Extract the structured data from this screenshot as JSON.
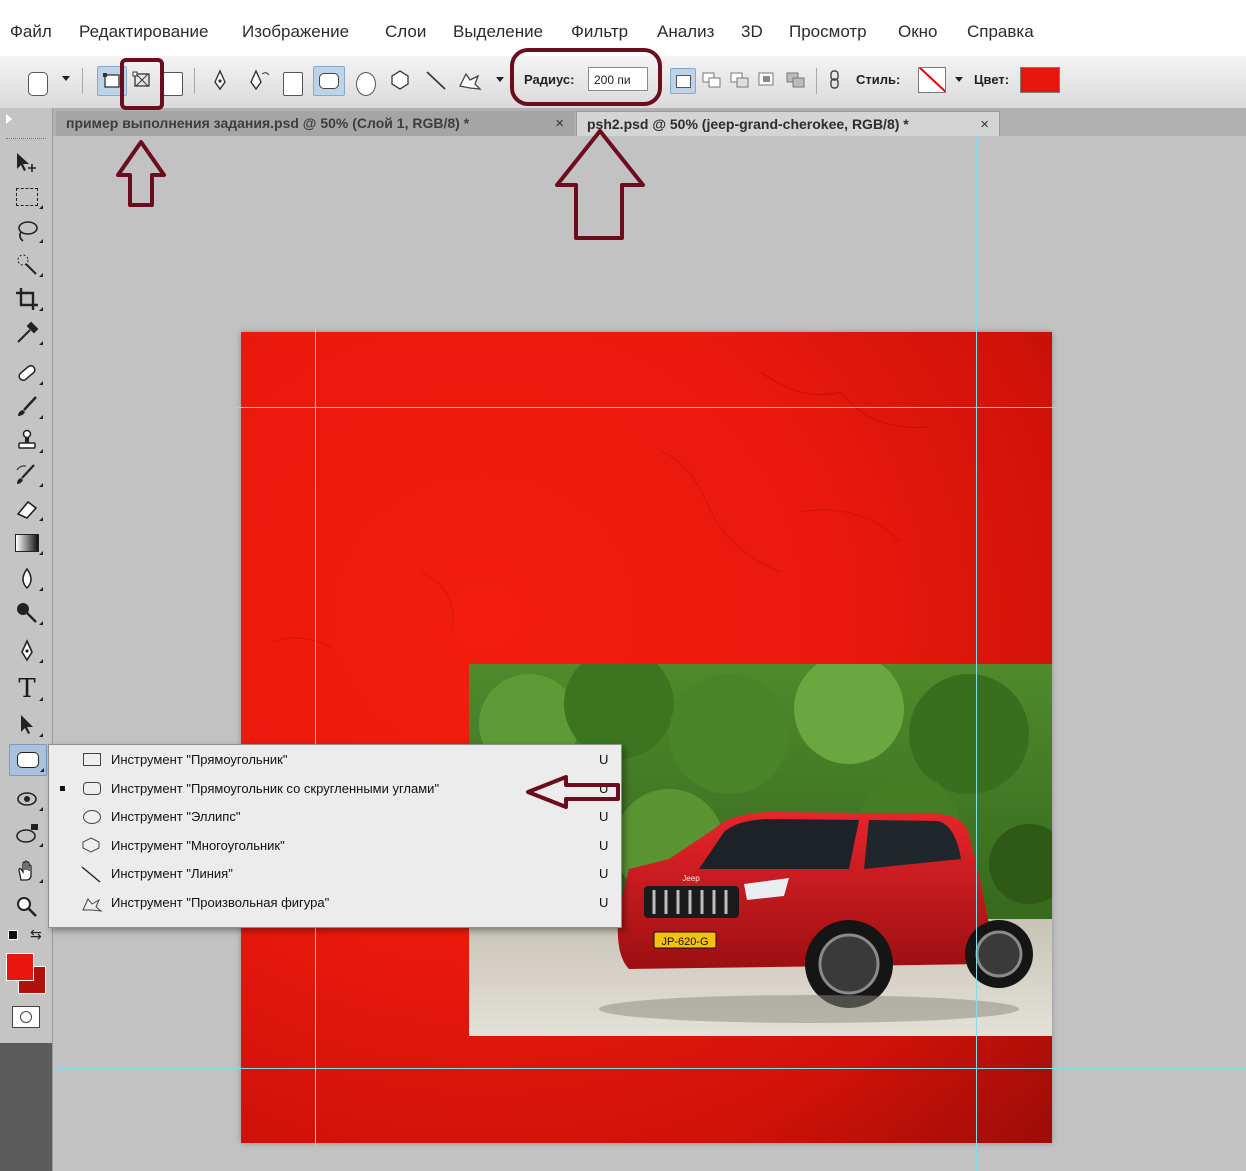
{
  "menu": [
    "Файл",
    "Редактирование",
    "Изображение",
    "Слои",
    "Выделение",
    "Фильтр",
    "Анализ",
    "3D",
    "Просмотр",
    "Окно",
    "Справка"
  ],
  "options": {
    "radius_label": "Радиус:",
    "radius_value": "200 пи",
    "style_label": "Стиль:",
    "color_label": "Цвет:",
    "shape_color": "#e8160f"
  },
  "tabs": [
    {
      "title": "пример выполнения задания.psd @ 50% (Слой 1, RGB/8) *",
      "close": "×"
    },
    {
      "title": "psh2.psd @ 50% (jeep-grand-cherokee, RGB/8) *",
      "close": "×"
    }
  ],
  "flyout": [
    {
      "label": "Инструмент \"Прямоугольник\"",
      "key": "U",
      "icon": "rectangle-icon",
      "selected": false
    },
    {
      "label": "Инструмент \"Прямоугольник со скругленными углами\"",
      "key": "U",
      "icon": "rounded-rectangle-icon",
      "selected": true
    },
    {
      "label": "Инструмент \"Эллипс\"",
      "key": "U",
      "icon": "ellipse-icon",
      "selected": false
    },
    {
      "label": "Инструмент \"Многоугольник\"",
      "key": "U",
      "icon": "polygon-icon",
      "selected": false
    },
    {
      "label": "Инструмент \"Линия\"",
      "key": "U",
      "icon": "line-icon",
      "selected": false
    },
    {
      "label": "Инструмент \"Произвольная фигура\"",
      "key": "U",
      "icon": "custom-shape-icon",
      "selected": false
    }
  ],
  "photo": {
    "plate": "JP-620-G",
    "brand": "Jeep"
  },
  "colors": {
    "foreground": "#e8160f",
    "background": "#b0120b",
    "annotation": "#6b0d1c"
  }
}
